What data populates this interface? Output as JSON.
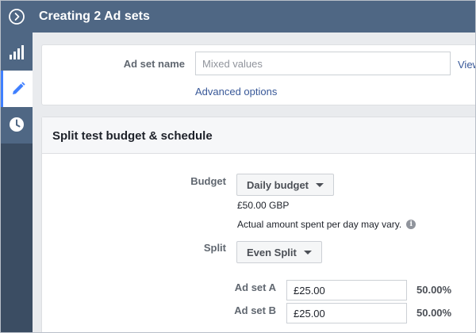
{
  "header": {
    "title": "Creating 2 Ad sets",
    "toggle_icon": "chevron-right-circle-icon"
  },
  "rail": {
    "items": [
      {
        "name": "stats",
        "icon": "bar-chart-icon",
        "active": false
      },
      {
        "name": "edit",
        "icon": "pencil-icon",
        "active": true
      },
      {
        "name": "schedule",
        "icon": "clock-icon",
        "active": false
      }
    ]
  },
  "adset_section": {
    "name_label": "Ad set name",
    "name_placeholder": "Mixed values",
    "view_link": "View",
    "advanced_link": "Advanced options"
  },
  "budget_section": {
    "title": "Split test budget & schedule",
    "budget_label": "Budget",
    "budget_dropdown": "Daily budget",
    "budget_amount": "£50.00 GBP",
    "budget_note": "Actual amount spent per day may vary.",
    "split_label": "Split",
    "split_dropdown": "Even Split",
    "ad_sets": [
      {
        "label": "Ad set A",
        "amount": "£25.00",
        "percent": "50.00%"
      },
      {
        "label": "Ad set B",
        "amount": "£25.00",
        "percent": "50.00%"
      }
    ]
  },
  "colors": {
    "header_bg": "#4f6784",
    "rail_dark": "#3b4d63",
    "link": "#385898"
  }
}
